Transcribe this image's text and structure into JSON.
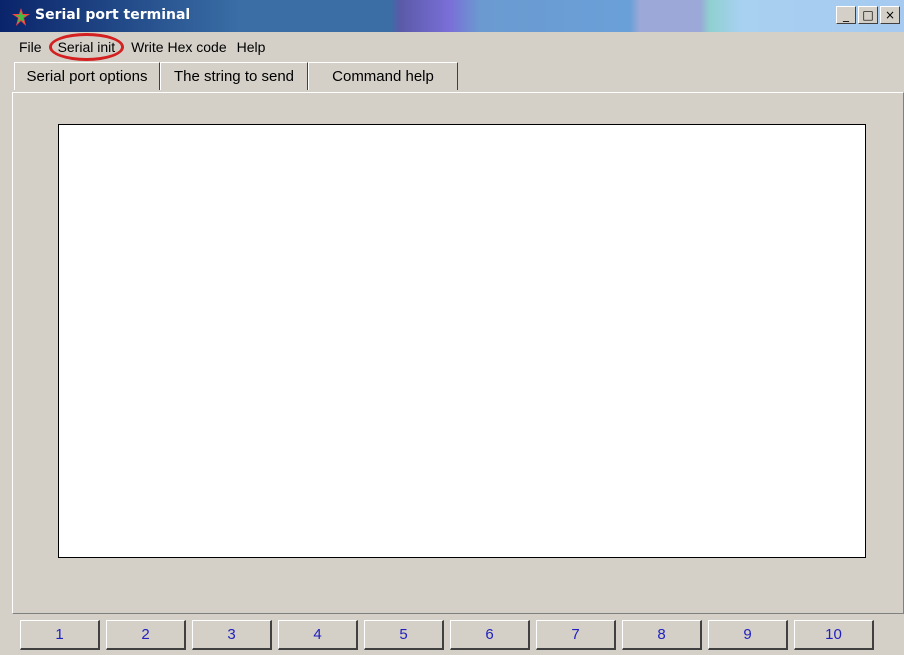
{
  "window": {
    "title": "Serial port terminal",
    "icon": "app-star-icon",
    "controls": {
      "minimize": "_",
      "maximize": "□",
      "close": "×"
    }
  },
  "menu": {
    "items": [
      "File",
      "Serial init",
      "Write Hex code",
      "Help"
    ]
  },
  "tabs": [
    "Serial port options",
    "The string to send",
    "Command help"
  ],
  "buttons": [
    "1",
    "2",
    "3",
    "4",
    "5",
    "6",
    "7",
    "8",
    "9",
    "10"
  ],
  "colors": {
    "highlight_circle": "#d42020",
    "button_text": "#2020c0",
    "face": "#d4d0c8"
  }
}
